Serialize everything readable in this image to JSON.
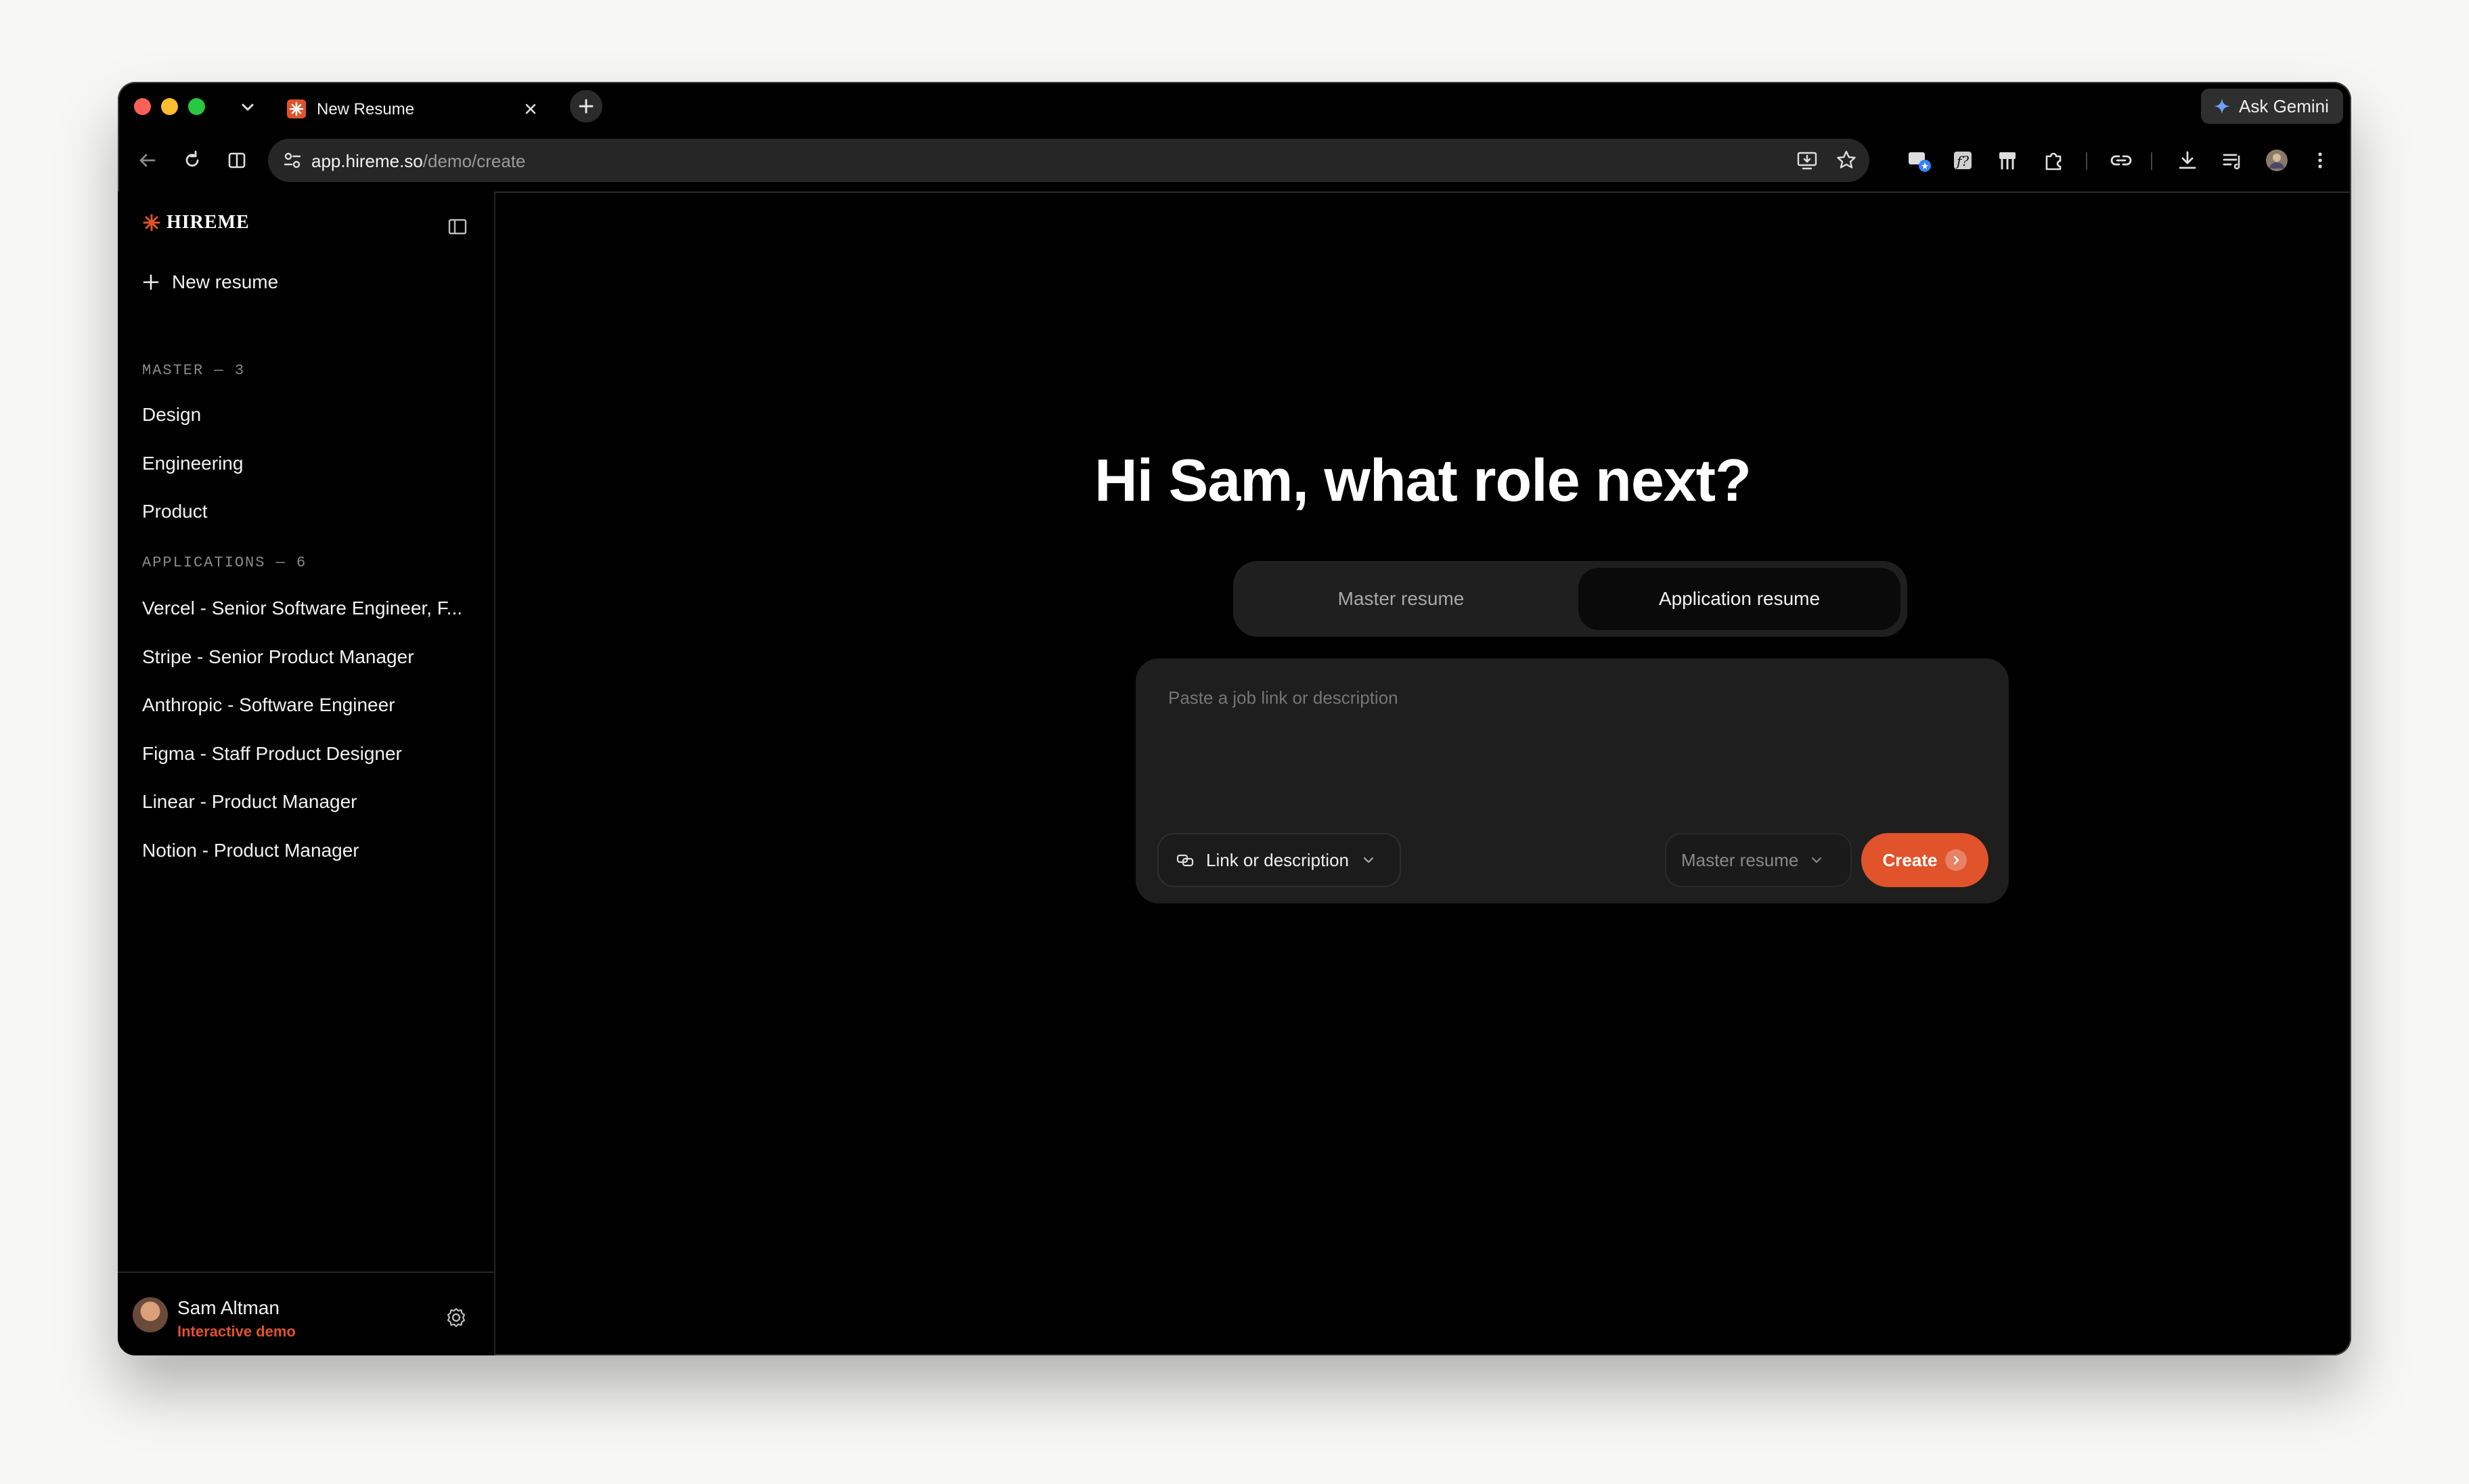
{
  "browser": {
    "tab_title": "New Resume",
    "url_host": "app.hireme.so",
    "url_path": "/demo/create",
    "gemini_label": "Ask Gemini"
  },
  "sidebar": {
    "logo_text": "HIREME",
    "new_resume_label": "New resume",
    "master_section_label": "MASTER — 3",
    "master_items": [
      "Design",
      "Engineering",
      "Product"
    ],
    "applications_section_label": "APPLICATIONS — 6",
    "application_items": [
      "Vercel - Senior Software Engineer, F...",
      "Stripe - Senior Product Manager",
      "Anthropic - Software Engineer",
      "Figma - Staff Product Designer",
      "Linear - Product Manager",
      "Notion - Product Manager"
    ],
    "user": {
      "name": "Sam Altman",
      "subtitle": "Interactive demo"
    }
  },
  "main": {
    "headline": "Hi Sam, what role next?",
    "toggle": {
      "master_label": "Master resume",
      "application_label": "Application resume",
      "selected": "Application resume"
    },
    "composer": {
      "placeholder": "Paste a job link or description",
      "input_type_label": "Link or description",
      "master_select_label": "Master resume",
      "create_label": "Create"
    }
  },
  "colors": {
    "accent": "#e0532b",
    "background": "#000000",
    "panel": "#1e1e1e"
  }
}
